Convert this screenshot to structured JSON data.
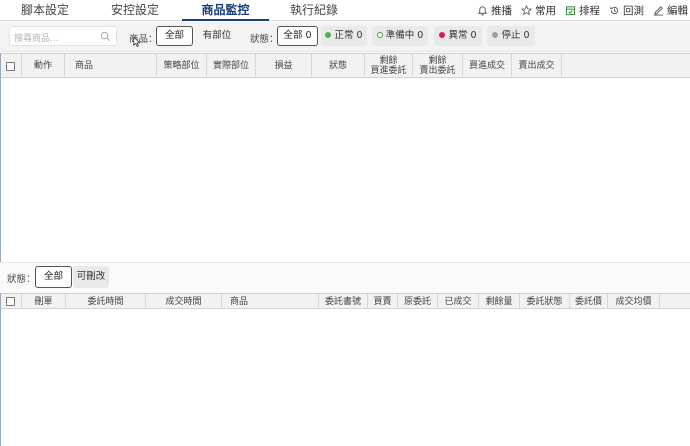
{
  "tabs": [
    {
      "label": "腳本設定"
    },
    {
      "label": "安控設定"
    },
    {
      "label": "商品監控"
    },
    {
      "label": "執行紀錄"
    }
  ],
  "actions": [
    {
      "label": "推播",
      "icon": "bell-icon"
    },
    {
      "label": "常用",
      "icon": "star-icon"
    },
    {
      "label": "排程",
      "icon": "calendar-icon"
    },
    {
      "label": "回測",
      "icon": "history-icon"
    },
    {
      "label": "編輯",
      "icon": "edit-icon"
    }
  ],
  "filter": {
    "search_placeholder": "搜尋商品...",
    "product_label": "商品：",
    "product_options": [
      "全部",
      "有部位"
    ],
    "status_label": "狀態：",
    "status_options": [
      {
        "label": "全部 0",
        "color": ""
      },
      {
        "label": "正常 0",
        "color": "#4caf50"
      },
      {
        "label": "準備中 0",
        "color": "#43a047"
      },
      {
        "label": "異常 0",
        "color": "#d81b60"
      },
      {
        "label": "停止 0",
        "color": "#9e9e9e"
      }
    ]
  },
  "table1": {
    "columns": [
      "動作",
      "商品",
      "策略部位",
      "實際部位",
      "損益",
      "狀態",
      "剩餘\n買進委託",
      "剩餘\n賣出委託",
      "買進成交",
      "賣出成交"
    ]
  },
  "status_filter": {
    "label": "狀態：",
    "options": [
      "全部",
      "可刪改"
    ]
  },
  "table2": {
    "columns": [
      "刪單",
      "委託時間",
      "成交時間",
      "商品",
      "委託書號",
      "買賣",
      "原委託",
      "已成交",
      "剩餘量",
      "委託狀態",
      "委託價",
      "成交均價"
    ]
  }
}
